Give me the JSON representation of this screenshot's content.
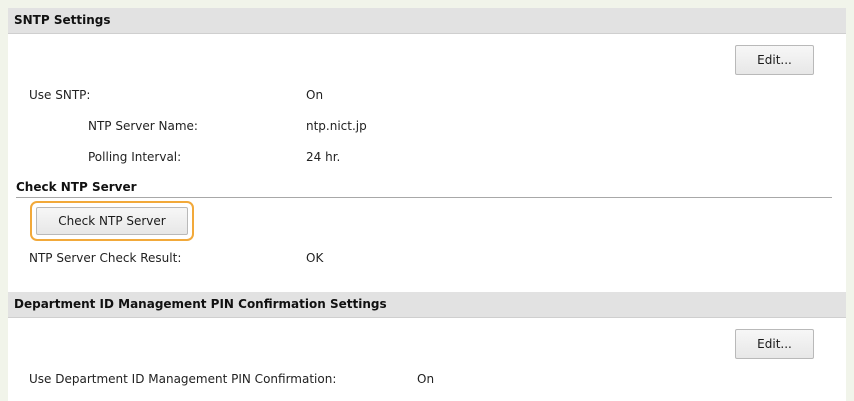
{
  "sntp": {
    "title": "SNTP Settings",
    "edit_label": "Edit...",
    "use_sntp_label": "Use SNTP:",
    "use_sntp_value": "On",
    "server_name_label": "NTP Server Name:",
    "server_name_value": "ntp.nict.jp",
    "polling_label": "Polling Interval:",
    "polling_value": "24 hr.",
    "check_heading": "Check NTP Server",
    "check_button_label": "Check NTP Server",
    "check_result_label": "NTP Server Check Result:",
    "check_result_value": "OK"
  },
  "department": {
    "title": "Department ID Management PIN Confirmation Settings",
    "edit_label": "Edit...",
    "use_pin_label": "Use Department ID Management PIN Confirmation:",
    "use_pin_value": "On"
  },
  "colors": {
    "highlight": "#f2a93a",
    "header_bg": "#e2e2e2",
    "page_bg": "#f1f4ea"
  }
}
